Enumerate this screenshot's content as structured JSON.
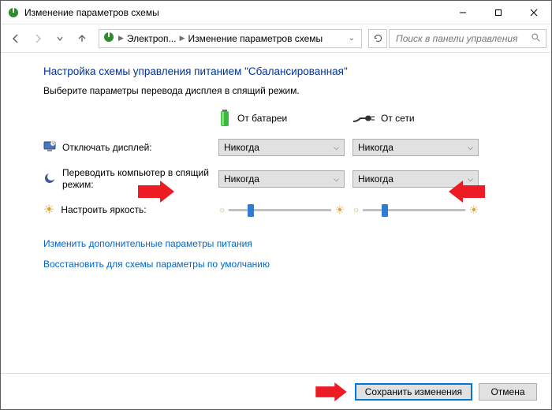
{
  "window": {
    "title": "Изменение параметров схемы"
  },
  "nav": {
    "breadcrumb1": "Электроп...",
    "breadcrumb2": "Изменение параметров схемы",
    "search_placeholder": "Поиск в панели управления"
  },
  "page": {
    "title": "Настройка схемы управления питанием \"Сбалансированная\"",
    "subtitle": "Выберите параметры перевода дисплея в спящий режим."
  },
  "columns": {
    "battery": "От батареи",
    "plugged": "От сети"
  },
  "rows": {
    "display_off": {
      "label": "Отключать дисплей:"
    },
    "sleep": {
      "label": "Переводить компьютер в спящий режим:"
    },
    "brightness": {
      "label": "Настроить яркость:"
    }
  },
  "values": {
    "display_off_battery": "Никогда",
    "display_off_plugged": "Никогда",
    "sleep_battery": "Никогда",
    "sleep_plugged": "Никогда",
    "brightness_battery_pct": 18,
    "brightness_plugged_pct": 18
  },
  "links": {
    "advanced": "Изменить дополнительные параметры питания",
    "restore": "Восстановить для схемы параметры по умолчанию"
  },
  "buttons": {
    "save": "Сохранить изменения",
    "cancel": "Отмена"
  },
  "annotations": {
    "arrows": [
      "sleep-battery-combo",
      "sleep-plugged-combo",
      "save-button"
    ]
  }
}
